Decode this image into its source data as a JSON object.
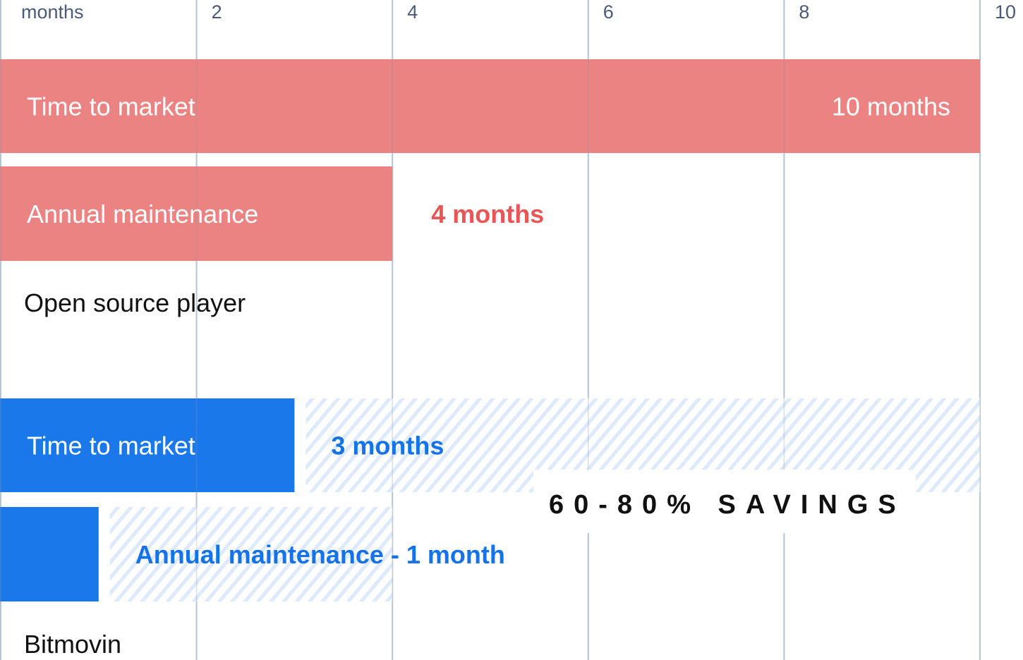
{
  "chart_data": {
    "type": "bar",
    "orientation": "horizontal",
    "xlabel": "months",
    "xlim": [
      0,
      10
    ],
    "xticks": [
      2,
      4,
      6,
      8,
      10
    ],
    "grid": true,
    "groups": [
      {
        "name": "Open source player",
        "bars": [
          {
            "label": "Time to market",
            "value": 10,
            "value_label": "10 months",
            "color": "#ec8383",
            "value_inside": true
          },
          {
            "label": "Annual maintenance",
            "value": 4,
            "value_label": "4 months",
            "color": "#ec8383",
            "value_inside": false
          }
        ]
      },
      {
        "name": "Bitmovin",
        "bars": [
          {
            "label": "Time to market",
            "value": 3,
            "value_label": "3 months",
            "color": "#1a78ea",
            "savings_to": 10
          },
          {
            "label": "",
            "value": 1,
            "value_label": "Annual maintenance - 1 month",
            "color": "#1a78ea",
            "savings_to": 4
          }
        ]
      }
    ],
    "annotation": "60-80% SAVINGS"
  },
  "colors": {
    "grid": "#c8d6e2",
    "tick_text": "#4a5a78",
    "red_bar": "#ec8383",
    "red_text": "#e85656",
    "blue_bar": "#1a78ea",
    "blue_text": "#1572e8",
    "hatch": "#dceafb"
  }
}
